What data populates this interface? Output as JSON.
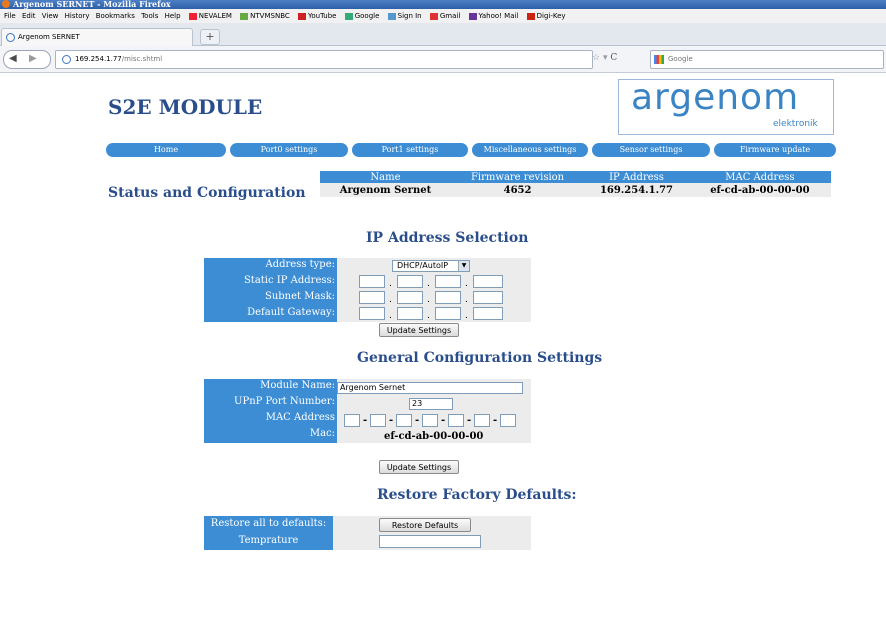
{
  "browser": {
    "window_title": "Argenom SERNET - Mozilla Firefox",
    "menu": [
      "File",
      "Edit",
      "View",
      "History",
      "Bookmarks",
      "Tools",
      "Help"
    ],
    "bookmarks": [
      "NEVALEM",
      "NTVMSNBC",
      "YouTube",
      "Google",
      "Sign In",
      "Gmail",
      "Yahoo! Mail",
      "Digi-Key"
    ],
    "tab_title": "Argenom SERNET",
    "new_tab": "+",
    "url_host": "169.254.1.77",
    "url_path": "/misc.shtml",
    "search_placeholder": "Google"
  },
  "header": {
    "title": "S2E MODULE",
    "logo_word": "argenom",
    "logo_sub": "elektronik"
  },
  "nav": [
    "Home",
    "Port0 settings",
    "Port1 settings",
    "Miscellaneous settings",
    "Sensor settings",
    "Firmware update"
  ],
  "status": {
    "title": "Status and Configuration",
    "columns": [
      "Name",
      "Firmware revision",
      "IP Address",
      "MAC Address"
    ],
    "values": [
      "Argenom Sernet",
      "4652",
      "169.254.1.77",
      "ef-cd-ab-00-00-00"
    ]
  },
  "ip_section": {
    "title": "IP Address Selection",
    "labels": [
      "Address type:",
      "Static IP Address:",
      "Subnet Mask:",
      "Default Gateway:"
    ],
    "address_type": "DHCP/AutoIP",
    "button": "Update Settings"
  },
  "general": {
    "title": "General Configuration Settings",
    "labels": [
      "Module Name:",
      "UPnP Port Number:",
      "MAC Address",
      "Mac:"
    ],
    "module_name": "Argenom Sernet",
    "upnp_port": "23",
    "mac_value": "ef-cd-ab-00-00-00",
    "button": "Update Settings"
  },
  "restore": {
    "title": "Restore Factory Defaults:",
    "labels": [
      "Restore all to defaults:",
      "Temprature"
    ],
    "button": "Restore Defaults"
  },
  "colors": {
    "accent": "#3c8dd4",
    "heading": "#2a4e8c",
    "cellbg": "#ececec"
  }
}
